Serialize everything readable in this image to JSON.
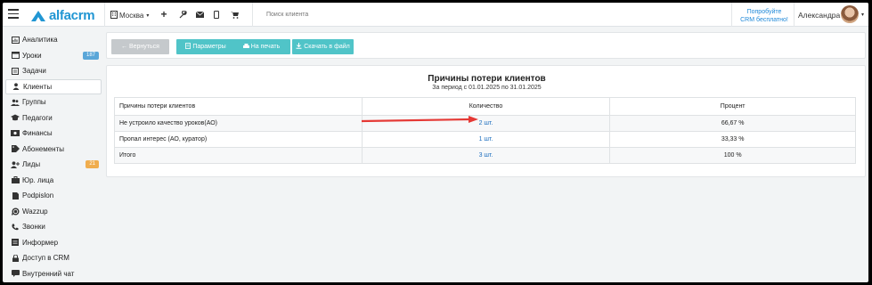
{
  "topbar": {
    "logo_text": "alfacrm",
    "city": "Москва",
    "search_placeholder": "Поиск клиента",
    "promo_line1": "Попробуйте",
    "promo_line2": "CRM бесплатно!",
    "user_name": "Александра",
    "icons": [
      "menu-icon",
      "building-icon",
      "plus-icon",
      "wrench-icon",
      "mail-icon",
      "phone-icon",
      "cart-icon"
    ]
  },
  "sidebar": {
    "items": [
      {
        "label": "Аналитика",
        "icon": "analytics-icon"
      },
      {
        "label": "Уроки",
        "icon": "calendar-icon",
        "badge": "187",
        "badge_color": "#5aa6d8"
      },
      {
        "label": "Задачи",
        "icon": "tasks-icon"
      },
      {
        "label": "Клиенты",
        "icon": "user-icon",
        "active": true
      },
      {
        "label": "Группы",
        "icon": "group-icon"
      },
      {
        "label": "Педагоги",
        "icon": "graduation-cap-icon"
      },
      {
        "label": "Финансы",
        "icon": "money-icon"
      },
      {
        "label": "Абонементы",
        "icon": "tag-icon"
      },
      {
        "label": "Лиды",
        "icon": "user-plus-icon",
        "badge": "21",
        "badge_color": "#f0ad4e"
      },
      {
        "label": "Юр. лица",
        "icon": "briefcase-icon"
      },
      {
        "label": "Podpislon",
        "icon": "file-icon"
      },
      {
        "label": "Wazzup",
        "icon": "whatsapp-icon"
      },
      {
        "label": "Звонки",
        "icon": "phone-icon"
      },
      {
        "label": "Информер",
        "icon": "list-icon"
      },
      {
        "label": "Доступ в CRM",
        "icon": "lock-icon"
      },
      {
        "label": "Внутренний чат",
        "icon": "chat-icon"
      }
    ]
  },
  "toolbar": {
    "back_label": "← Вернуться",
    "params_label": "Параметры",
    "print_label": "На печать",
    "download_label": "Скачать в файл"
  },
  "report": {
    "title": "Причины потери клиентов",
    "period": "За период с 01.01.2025 по 31.01.2025",
    "columns": [
      "Причины потери клиентов",
      "Количество",
      "Процент"
    ],
    "rows": [
      {
        "reason": "Не устроило качество уроков(АО)",
        "count": "2 шт.",
        "percent": "66,67 %"
      },
      {
        "reason": "Пропал интерес (АО, куратор)",
        "count": "1 шт.",
        "percent": "33,33 %"
      }
    ],
    "total": {
      "label": "Итого",
      "count": "3 шт.",
      "percent": "100 %"
    }
  },
  "colors": {
    "accent": "#2196d3",
    "teal_button": "#50c4c8",
    "arrow": "#e53935"
  }
}
